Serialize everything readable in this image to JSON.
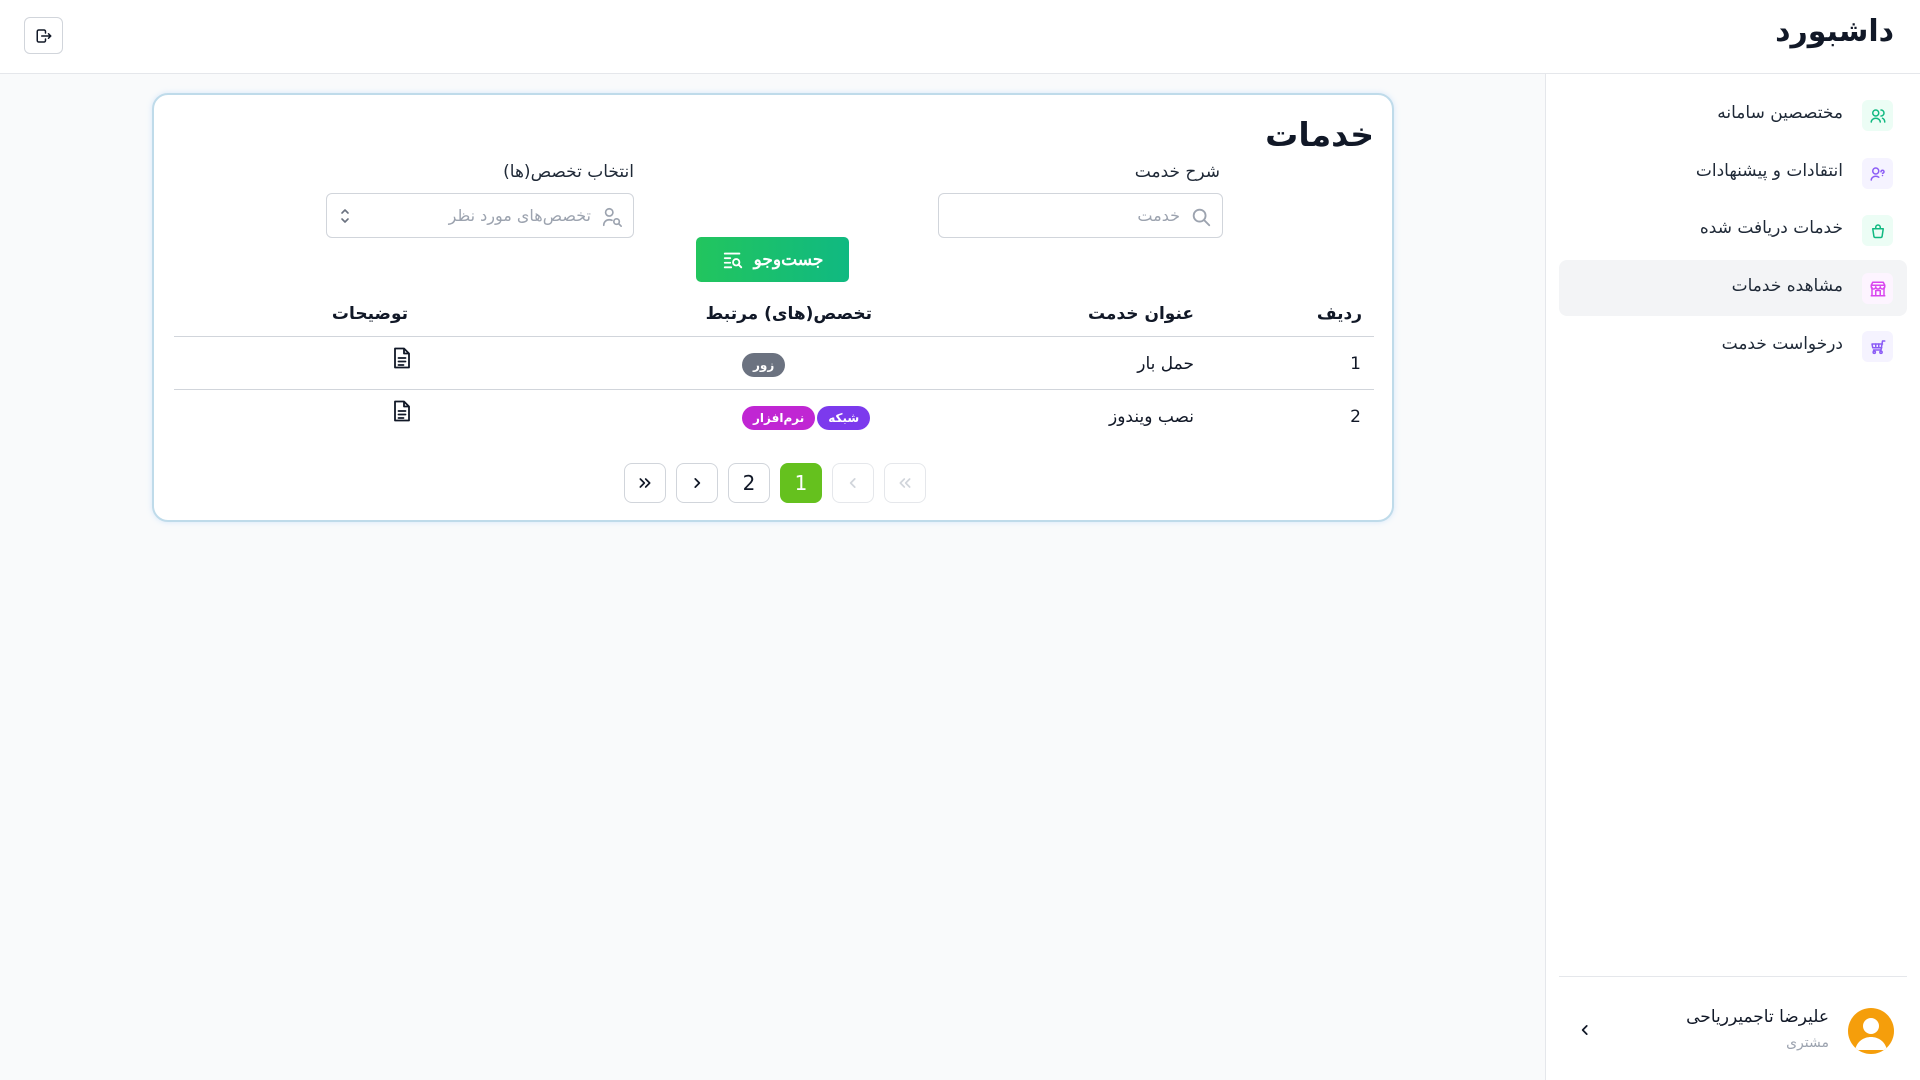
{
  "header": {
    "brand": "داشبورد",
    "logout_icon": "logout-icon"
  },
  "sidebar": {
    "items": [
      {
        "label": "مختصصین سامانه",
        "icon": "users-icon",
        "icon_color": "#10b981",
        "icon_bg": "#ecfdf5"
      },
      {
        "label": "انتقادات و پیشنهادات",
        "icon": "user-question-icon",
        "icon_color": "#8b5cf6",
        "icon_bg": "#f5f3ff"
      },
      {
        "label": "خدمات دریافت شده",
        "icon": "basket-icon",
        "icon_color": "#10b981",
        "icon_bg": "#ecfdf5"
      },
      {
        "label": "مشاهده خدمات",
        "icon": "store-icon",
        "icon_color": "#d946ef",
        "icon_bg": "#fdf4ff",
        "active": true
      },
      {
        "label": "درخواست خدمت",
        "icon": "cart-icon",
        "icon_color": "#8b5cf6",
        "icon_bg": "#f5f3ff"
      }
    ],
    "user": {
      "name": "علیرضا تاجمیرریاحی",
      "role": "مشتری"
    }
  },
  "main": {
    "title": "خدمات",
    "filters": {
      "description_label": "شرح خدمت",
      "description_placeholder": "خدمت",
      "specialty_label": "انتخاب تخصص(ها)",
      "specialty_placeholder": "تخصص‌های مورد نظر",
      "search_button": "جست‌وجو"
    },
    "table": {
      "headers": {
        "row": "ردیف",
        "title": "عنوان خدمت",
        "specialties": "تخصص(های) مرتبط",
        "notes": "توضیحات"
      },
      "rows": [
        {
          "index": "1",
          "title": "حمل بار",
          "badges": [
            {
              "label": "زور",
              "color": "#6b7280"
            }
          ]
        },
        {
          "index": "2",
          "title": "نصب ویندوز",
          "badges": [
            {
              "label": "نرم‌افزار",
              "color": "#c026d3"
            },
            {
              "label": "شبکه",
              "color": "#7c3aed"
            }
          ]
        }
      ]
    },
    "pagination": {
      "current_page": "1",
      "pages": [
        "1",
        "2"
      ],
      "active_color": "#65c11e"
    }
  }
}
